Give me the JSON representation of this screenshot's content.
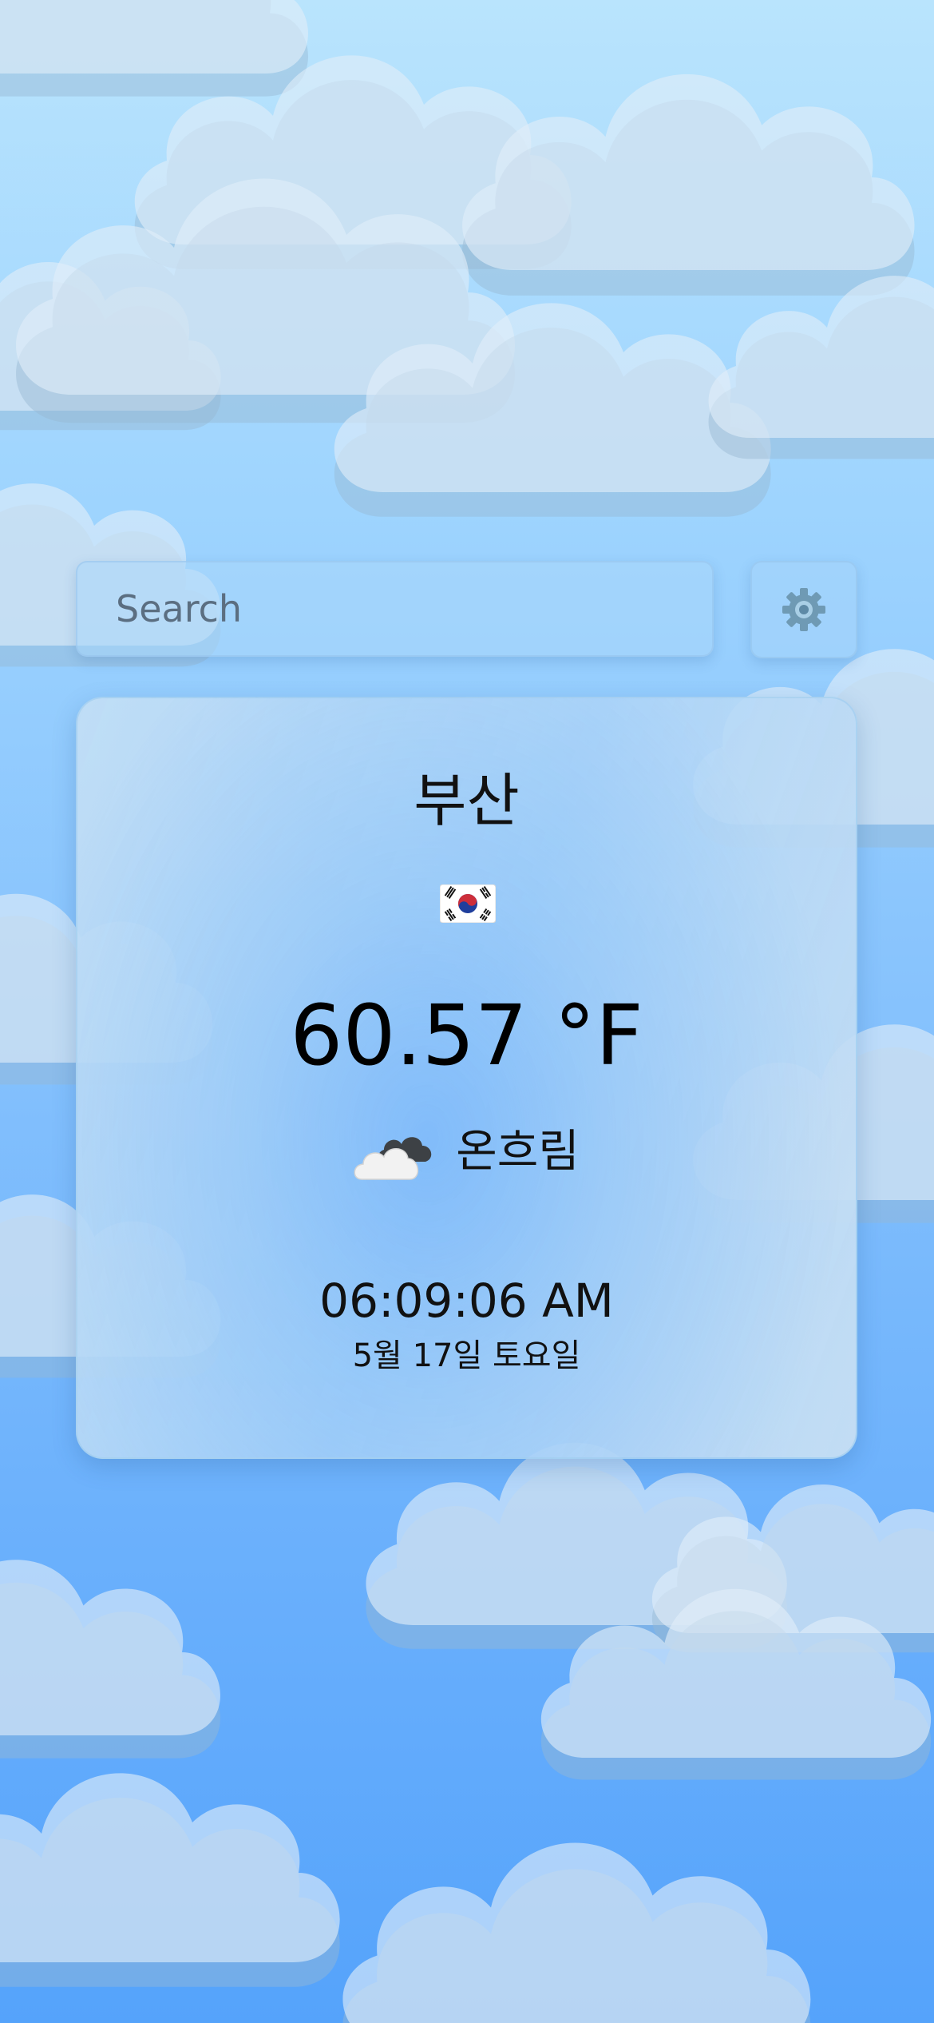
{
  "search": {
    "placeholder": "Search",
    "value": ""
  },
  "settings": {
    "icon": "gear-icon"
  },
  "weather": {
    "city": "부산",
    "country_flag": "south-korea-flag-icon",
    "temperature": "60.57 °F",
    "condition_icon": "overcast-cloud-icon",
    "condition": "온흐림",
    "time": "06:09:06 AM",
    "date": "5월 17일 토요일"
  },
  "colors": {
    "sky_top": "#b9e4fd",
    "sky_bottom": "#55a3fb",
    "text": "#111111"
  }
}
